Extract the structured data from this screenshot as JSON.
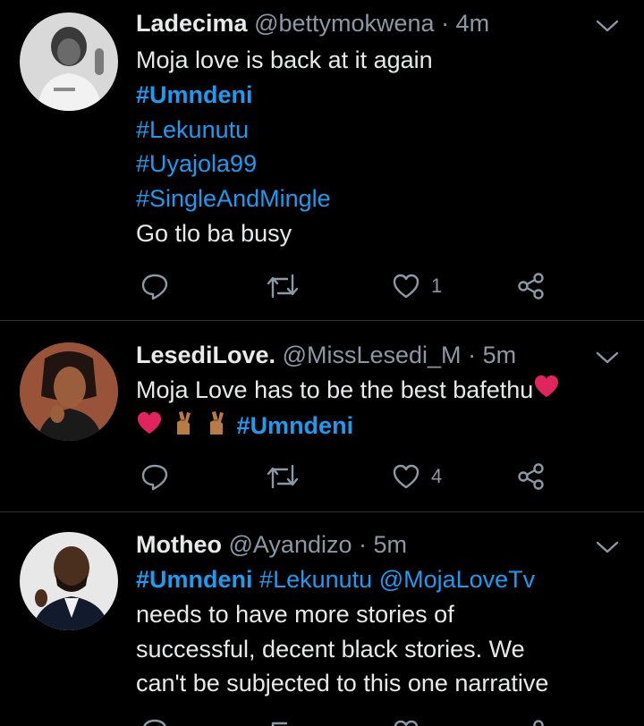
{
  "tweets": [
    {
      "name": "Ladecima",
      "handle": "@bettymokwena",
      "time": "4m",
      "lines": [
        "Moja love is back at it again",
        "#Umndeni",
        "#Lekunutu",
        "#Uyajola99",
        "#SingleAndMingle",
        "Go tlo ba busy"
      ],
      "likes": "1",
      "avatar": "avatar-grayscale-woman"
    },
    {
      "name": "LesediLove.",
      "handle": "@MissLesedi_M",
      "time": "5m",
      "line1": "Moja Love has to be the best bafethu",
      "line2_tag": "#Umndeni",
      "likes": "4",
      "emoji": [
        "red-heart",
        "red-heart",
        "crossed-fingers",
        "crossed-fingers"
      ],
      "avatar": "avatar-woman"
    },
    {
      "name": "Motheo",
      "handle": "@Ayandizo",
      "time": "5m",
      "line1_tags": [
        "#Umndeni",
        "#Lekunutu",
        "@MojaLoveTv"
      ],
      "lines": [
        "needs to have more stories of",
        "successful, decent black stories. We",
        "can't be subjected to this one narrative"
      ],
      "avatar": "avatar-man"
    }
  ],
  "separator": "·",
  "colors": {
    "background": "#000000",
    "text": "#e7e9ea",
    "muted": "#8b98a5",
    "link": "#1d9bf0",
    "heart": "#e0245e"
  },
  "icons": [
    "reply-icon",
    "retweet-icon",
    "like-icon",
    "share-icon",
    "chevron-down-icon"
  ]
}
